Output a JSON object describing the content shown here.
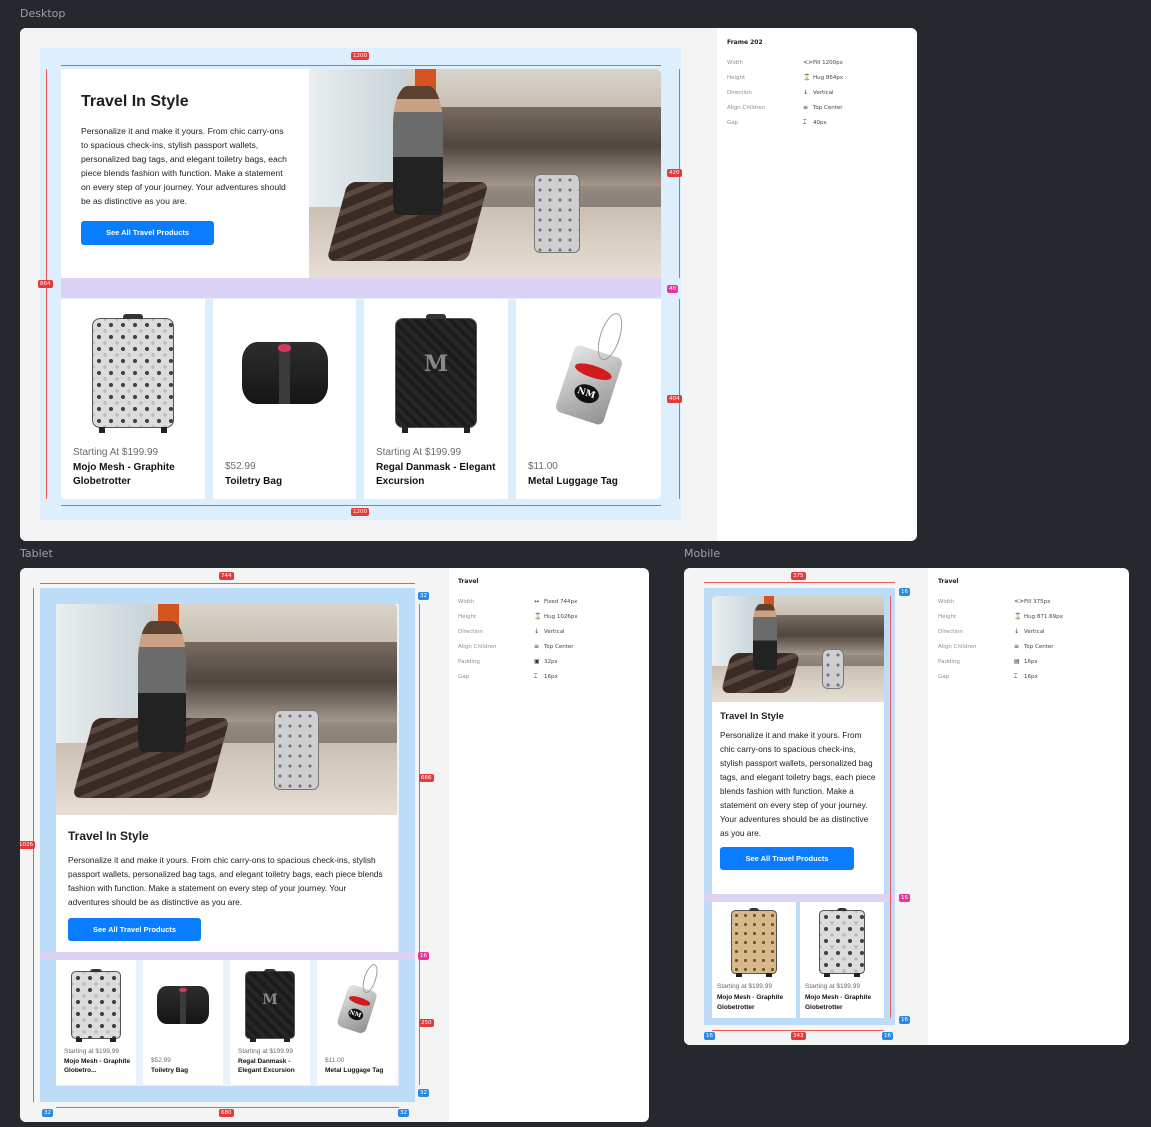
{
  "labels": {
    "desktop": "Desktop",
    "tablet": "Tablet",
    "mobile": "Mobile"
  },
  "hero": {
    "title": "Travel In Style",
    "body": "Personalize it and make it yours. From chic carry-ons to spacious check-ins, stylish passport wallets, personalized bag tags, and elegant toiletry bags, each piece blends fashion with function. Make a statement on every step of your journey. Your adventures should be as distinctive as you are.",
    "cta": "See All Travel Products"
  },
  "products_desktop": [
    {
      "price": "Starting At $199.99",
      "name": "Mojo Mesh - Graphite Globetrotter"
    },
    {
      "price": "$52.99",
      "name": "Toiletry Bag"
    },
    {
      "price": "Starting At $199.99",
      "name": "Regal Danmask - Elegant Excursion"
    },
    {
      "price": "$11.00",
      "name": "Metal Luggage Tag"
    }
  ],
  "products_tablet": [
    {
      "price": "Starting at $199.99",
      "name": "Mojo Mesh - Graphite Globetro..."
    },
    {
      "price": "$52.99",
      "name": "Toiletry Bag"
    },
    {
      "price": "Starting at $199.99",
      "name": "Regal Danmask - Elegant Excursion"
    },
    {
      "price": "$11.00",
      "name": "Metal Luggage Tag"
    }
  ],
  "products_mobile": [
    {
      "price": "Starting at $199.99",
      "name": "Mojo Mesh - Graphite Globetrotter"
    },
    {
      "price": "Starting at $199.99",
      "name": "Mojo Mesh - Graphite Globetrotter"
    }
  ],
  "desktop_props": {
    "title": "Frame 202",
    "rows": [
      {
        "k": "Width",
        "icon": "<>",
        "v": "Fill 1200px"
      },
      {
        "k": "Height",
        "icon": "⌛",
        "v": "Hug 864px"
      },
      {
        "k": "Direction",
        "icon": "↓",
        "v": "Vertical"
      },
      {
        "k": "Align Children",
        "icon": "≡",
        "v": "Top Center"
      },
      {
        "k": "Gap",
        "icon": "⌶",
        "v": "40px"
      }
    ]
  },
  "tablet_props": {
    "title": "Travel",
    "rows": [
      {
        "k": "Width",
        "icon": "↔",
        "v": "Fixed 744px"
      },
      {
        "k": "Height",
        "icon": "⌛",
        "v": "Hug 1026px"
      },
      {
        "k": "Direction",
        "icon": "↓",
        "v": "Vertical"
      },
      {
        "k": "Align Children",
        "icon": "≡",
        "v": "Top Center"
      },
      {
        "k": "Padding",
        "icon": "▣",
        "v": "32px"
      },
      {
        "k": "Gap",
        "icon": "⌶",
        "v": "16px"
      }
    ]
  },
  "mobile_props": {
    "title": "Travel",
    "rows": [
      {
        "k": "Width",
        "icon": "<>",
        "v": "Fill 375px"
      },
      {
        "k": "Height",
        "icon": "⌛",
        "v": "Hug 871.69px"
      },
      {
        "k": "Direction",
        "icon": "↓",
        "v": "Vertical"
      },
      {
        "k": "Align Children",
        "icon": "≡",
        "v": "Top Center"
      },
      {
        "k": "Padding",
        "icon": "▤",
        "v": "16px"
      },
      {
        "k": "Gap",
        "icon": "⌶",
        "v": "16px"
      }
    ]
  },
  "measures": {
    "d_w_top": "1200",
    "d_w_bot": "1200",
    "d_h": "864",
    "d_img_h": "420",
    "d_gap": "40",
    "d_cards_h": "404",
    "t_w": "744",
    "t_h": "1026",
    "t_pad_tr": "32",
    "t_img_h": "666",
    "t_gap": "16",
    "t_cards_h": "250",
    "t_pad_br": "32",
    "t_pad_bl": "32",
    "t_inner": "680",
    "t_pad_brr": "32",
    "m_w": "375",
    "m_pad_tr": "16",
    "m_gap": "16",
    "m_pad_br": "16",
    "m_pad_bl": "16",
    "m_inner": "343",
    "m_pad_brr": "16"
  },
  "colors": {
    "bg": "#25282c",
    "accent": "#0a7cff",
    "frame": "#ddeefc",
    "guide": "#f05a5a"
  }
}
